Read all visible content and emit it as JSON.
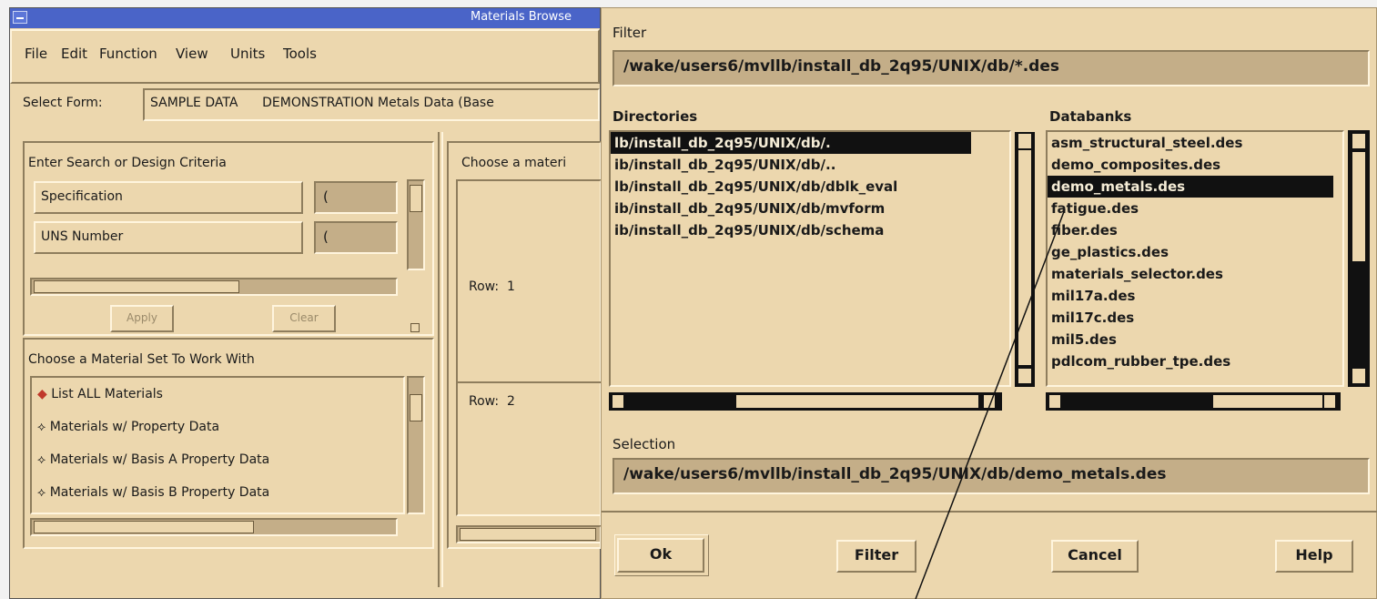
{
  "left_window": {
    "title": "Materials Browse",
    "menu": [
      "File",
      "Edit",
      "Function",
      "View",
      "Units",
      "Tools"
    ],
    "select_form_label": "Select Form:",
    "select_form_value": "SAMPLE DATA      DEMONSTRATION Metals Data (Base",
    "search_section_title": "Enter Search or Design Criteria",
    "criteria": [
      "Specification",
      "UNS Number"
    ],
    "criteria_values": [
      "(",
      "("
    ],
    "apply_label": "Apply",
    "clear_label": "Clear",
    "material_set_title": "Choose a Material Set To Work With",
    "material_options": [
      "List ALL Materials",
      "Materials w/ Property Data",
      "Materials w/ Basis A Property Data",
      "Materials w/ Basis B Property Data"
    ],
    "choose_material_title": "Choose a materi",
    "rows": [
      {
        "label": "Row:",
        "num": "1"
      },
      {
        "label": "Row:",
        "num": "2"
      }
    ]
  },
  "dialog": {
    "filter_label": "Filter",
    "filter_value": "/wake/users6/mvllb/install_db_2q95/UNIX/db/*.des",
    "directories_label": "Directories",
    "directories": [
      "lb/install_db_2q95/UNIX/db/.",
      "ib/install_db_2q95/UNIX/db/..",
      "lb/install_db_2q95/UNIX/db/dblk_eval",
      "ib/install_db_2q95/UNIX/db/mvform",
      "ib/install_db_2q95/UNIX/db/schema"
    ],
    "databanks_label": "Databanks",
    "databanks": [
      "asm_structural_steel.des",
      "demo_composites.des",
      "demo_metals.des",
      "fatigue.des",
      "fiber.des",
      "ge_plastics.des",
      "materials_selector.des",
      "mil17a.des",
      "mil17c.des",
      "mil5.des",
      "pdlcom_rubber_tpe.des"
    ],
    "selection_label": "Selection",
    "selection_value": "/wake/users6/mvllb/install_db_2q95/UNIX/db/demo_metals.des",
    "buttons": {
      "ok": "Ok",
      "filter": "Filter",
      "cancel": "Cancel",
      "help": "Help"
    }
  },
  "colors": {
    "panel": "#ecd7ae",
    "field": "#c4ae88",
    "title_bar": "#4a64c8",
    "selection": "#111111"
  }
}
